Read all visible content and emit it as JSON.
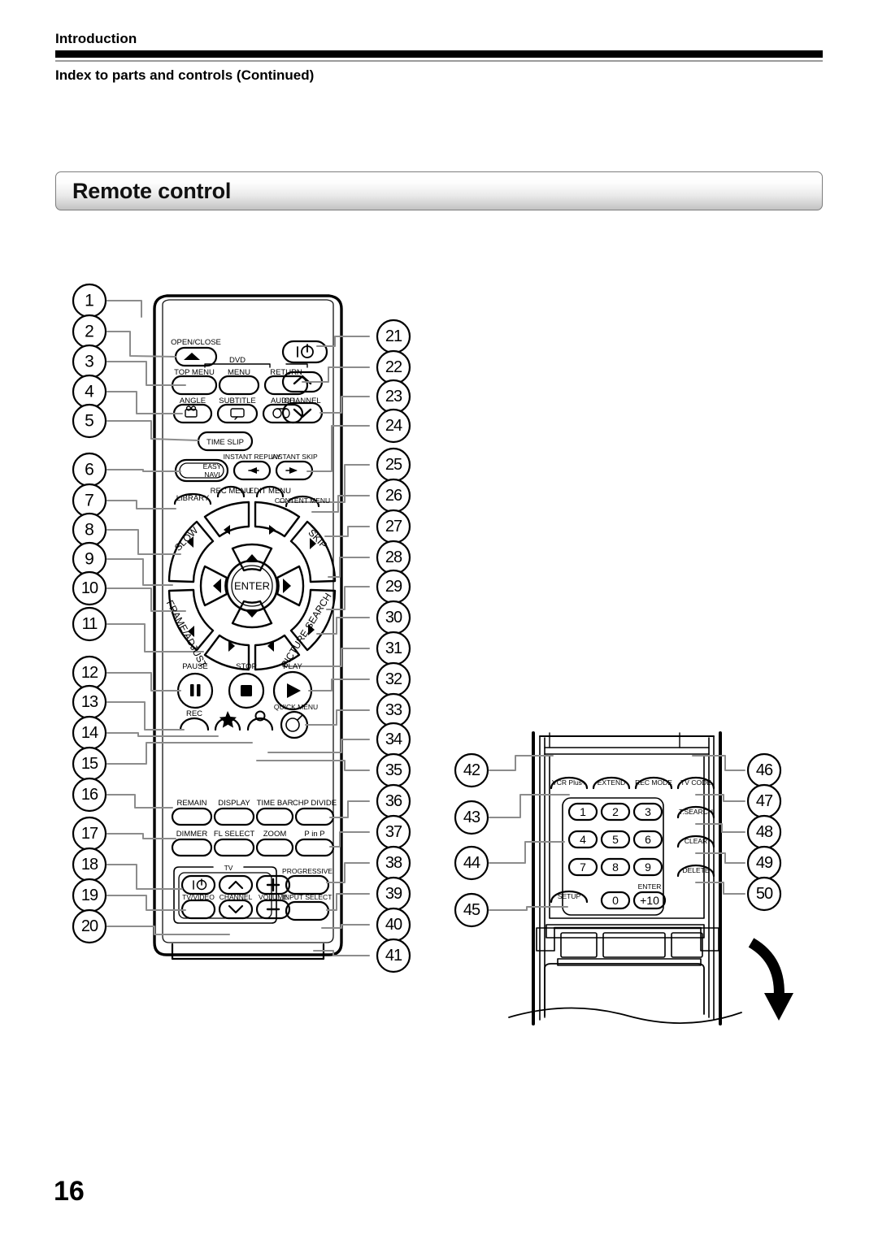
{
  "header": {
    "eyebrow": "Introduction",
    "title": "Index to parts and controls (Continued)"
  },
  "section": {
    "title": "Remote control"
  },
  "page_number": "16",
  "figure": {
    "name": "remote-control-diagram",
    "remote_labels": {
      "open_close": "OPEN/CLOSE",
      "dvd_group": "DVD",
      "top_menu": "TOP MENU",
      "menu": "MENU",
      "return": "RETURN",
      "angle": "ANGLE",
      "subtitle": "SUBTITLE",
      "audio": "AUDIO",
      "channel": "CHANNEL",
      "time_slip": "TIME SLIP",
      "instant_replay": "INSTANT REPLAY",
      "instant_skip": "INSTANT SKIP",
      "easy": "EASY",
      "navi": "NAVI",
      "rec_menu": "REC MENU",
      "edit_menu": "EDIT MENU",
      "library": "LIBRARY",
      "content_menu": "CONTENT MENU",
      "slow": "SLOW",
      "skip": "SKIP",
      "frame_adjust": "FRAME/ADJUST",
      "picture_search": "PICTURE SEARCH",
      "enter": "ENTER",
      "pause": "PAUSE",
      "stop": "STOP",
      "play": "PLAY",
      "rec": "REC",
      "quick_menu": "QUICK MENU",
      "remain": "REMAIN",
      "display": "DISPLAY",
      "time_bar": "TIME BAR",
      "chp_divide": "CHP DIVIDE",
      "dimmer": "DIMMER",
      "fl_select": "FL SELECT",
      "zoom": "ZOOM",
      "p_in_p": "P in P",
      "tv_group": "TV",
      "tv_video": "TV/VIDEO",
      "volume": "VOLUME",
      "progressive": "PROGRESSIVE",
      "input_select": "INPUT SELECT"
    },
    "keypad_labels": {
      "vcr_plus": "VCR Plus+",
      "extend": "EXTEND",
      "rec_mode": "REC MODE",
      "tv_code": "TV CODE",
      "t_search": "T.SEARCH",
      "clear": "CLEAR",
      "delete": "DELETE",
      "setup": "SETUP",
      "enter": "ENTER",
      "keys": [
        "1",
        "2",
        "3",
        "4",
        "5",
        "6",
        "7",
        "8",
        "9",
        "0",
        "+10"
      ]
    },
    "callouts_left": [
      "1",
      "2",
      "3",
      "4",
      "5",
      "6",
      "7",
      "8",
      "9",
      "10",
      "11",
      "12",
      "13",
      "14",
      "15",
      "16",
      "17",
      "18",
      "19",
      "20"
    ],
    "callouts_right": [
      "21",
      "22",
      "23",
      "24",
      "25",
      "26",
      "27",
      "28",
      "29",
      "30",
      "31",
      "32",
      "33",
      "34",
      "35",
      "36",
      "37",
      "38",
      "39",
      "40",
      "41"
    ],
    "callouts_keypad_left": [
      "42",
      "43",
      "44",
      "45"
    ],
    "callouts_keypad_right": [
      "46",
      "47",
      "48",
      "49",
      "50"
    ],
    "icons": {
      "power": "power-icon",
      "eject": "eject-icon",
      "angle": "camera-angle-icon",
      "subtitle": "subtitle-icon",
      "audio": "audio-icon",
      "channel_up": "chevron-up-icon",
      "channel_down": "chevron-down-icon",
      "instant_replay": "replay-arrow-icon",
      "instant_skip": "skip-arrow-icon",
      "pause": "pause-icon",
      "stop": "stop-icon",
      "play": "play-icon",
      "rec": "record-icon",
      "star": "star-icon",
      "quick_menu": "quick-menu-icon",
      "volume_up": "plus-icon",
      "volume_down": "minus-icon",
      "cover_arrow": "curved-down-arrow-icon"
    }
  }
}
